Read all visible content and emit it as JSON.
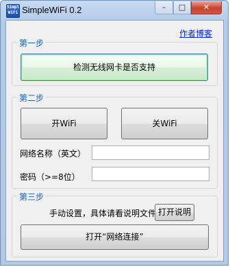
{
  "window": {
    "title": "SimpleWiFi 0.2",
    "icon_text": "Simple WiFi",
    "minimize_glyph": "–",
    "maximize_glyph": "□",
    "close_glyph": "✕"
  },
  "header": {
    "author_link": "作者博客"
  },
  "step1": {
    "title": "第一步",
    "check_button": "检测无线网卡是否支持"
  },
  "step2": {
    "title": "第二步",
    "on_button": "开WiFi",
    "off_button": "关WiFi",
    "ssid_label": "网络名称（英文）",
    "ssid_value": "",
    "password_label": "密码（>=8位）",
    "password_value": ""
  },
  "step3": {
    "title": "第三步",
    "manual_text": "手动设置，具体请看说明文件",
    "open_readme_button": "打开说明",
    "open_network_button": "打开“网络连接”"
  }
}
